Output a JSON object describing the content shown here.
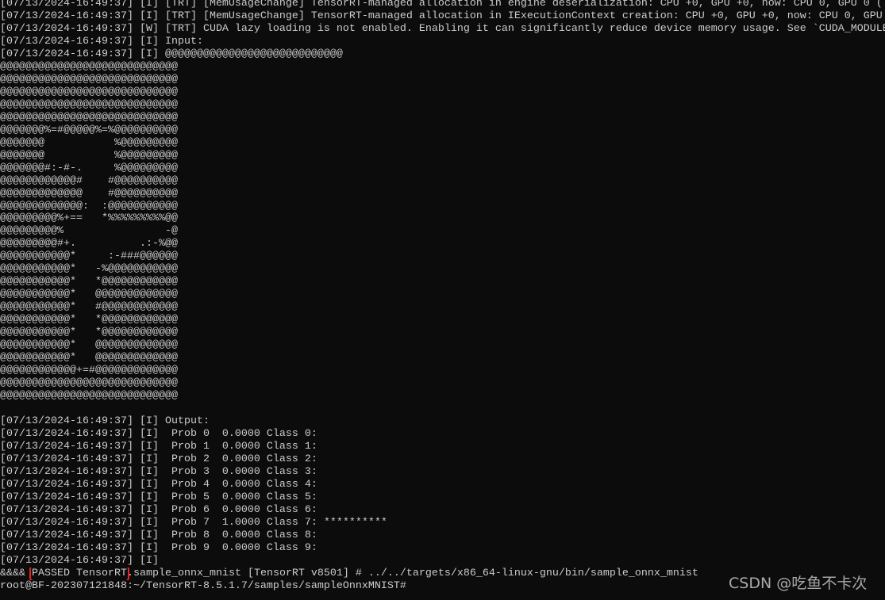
{
  "terminal": {
    "lines": [
      "[07/13/2024-16:49:37] [I] [TRT] [MemUsageChange] TensorRT-managed allocation in engine deserialization: CPU +0, GPU +0, now: CPU 0, GPU 0 (",
      "[07/13/2024-16:49:37] [I] [TRT] [MemUsageChange] TensorRT-managed allocation in IExecutionContext creation: CPU +0, GPU +0, now: CPU 0, GPU",
      "[07/13/2024-16:49:37] [W] [TRT] CUDA lazy loading is not enabled. Enabling it can significantly reduce device memory usage. See `CUDA_MODULE",
      "[07/13/2024-16:49:37] [I] Input:",
      "[07/13/2024-16:49:37] [I] @@@@@@@@@@@@@@@@@@@@@@@@@@@@",
      "@@@@@@@@@@@@@@@@@@@@@@@@@@@@",
      "@@@@@@@@@@@@@@@@@@@@@@@@@@@@",
      "@@@@@@@@@@@@@@@@@@@@@@@@@@@@",
      "@@@@@@@@@@@@@@@@@@@@@@@@@@@@",
      "@@@@@@@@@@@@@@@@@@@@@@@@@@@@",
      "@@@@@@@%=#@@@@@%=%@@@@@@@@@@",
      "@@@@@@@           %@@@@@@@@@",
      "@@@@@@@           %@@@@@@@@@",
      "@@@@@@@#:-#-.     %@@@@@@@@@",
      "@@@@@@@@@@@@#    #@@@@@@@@@@",
      "@@@@@@@@@@@@@    #@@@@@@@@@@",
      "@@@@@@@@@@@@@:  :@@@@@@@@@@@",
      "@@@@@@@@@%+==   *%%%%%%%%%@@",
      "@@@@@@@@@%                -@",
      "@@@@@@@@@#+.          .:-%@@",
      "@@@@@@@@@@@*     :-###@@@@@@",
      "@@@@@@@@@@@*   -%@@@@@@@@@@@",
      "@@@@@@@@@@@*   *@@@@@@@@@@@@",
      "@@@@@@@@@@@*   @@@@@@@@@@@@@",
      "@@@@@@@@@@@*   #@@@@@@@@@@@@",
      "@@@@@@@@@@@*   *@@@@@@@@@@@@",
      "@@@@@@@@@@@*   *@@@@@@@@@@@@",
      "@@@@@@@@@@@*   @@@@@@@@@@@@@",
      "@@@@@@@@@@@*   @@@@@@@@@@@@@",
      "@@@@@@@@@@@@+=#@@@@@@@@@@@@@",
      "@@@@@@@@@@@@@@@@@@@@@@@@@@@@",
      "@@@@@@@@@@@@@@@@@@@@@@@@@@@@",
      "",
      "[07/13/2024-16:49:37] [I] Output:",
      "[07/13/2024-16:49:37] [I]  Prob 0  0.0000 Class 0:",
      "[07/13/2024-16:49:37] [I]  Prob 1  0.0000 Class 1:",
      "[07/13/2024-16:49:37] [I]  Prob 2  0.0000 Class 2:",
      "[07/13/2024-16:49:37] [I]  Prob 3  0.0000 Class 3:",
      "[07/13/2024-16:49:37] [I]  Prob 4  0.0000 Class 4:",
      "[07/13/2024-16:49:37] [I]  Prob 5  0.0000 Class 5:",
      "[07/13/2024-16:49:37] [I]  Prob 6  0.0000 Class 6:",
      "[07/13/2024-16:49:37] [I]  Prob 7  1.0000 Class 7: **********",
      "[07/13/2024-16:49:37] [I]  Prob 8  0.0000 Class 8:",
      "[07/13/2024-16:49:37] [I]  Prob 9  0.0000 Class 9:",
      "[07/13/2024-16:49:37] [I]"
    ],
    "result_line": {
      "prefix": "&&&& ",
      "status": "PASSED TensorRT",
      "rest": ".sample_onnx_mnist [TensorRT v8501] # ../../targets/x86_64-linux-gnu/bin/sample_onnx_mnist"
    },
    "prompt": "root@BF-202307121848:~/TensorRT-8.5.1.7/samples/sampleOnnxMNIST#"
  },
  "watermark": "CSDN @吃鱼不卡次",
  "colors": {
    "background": "#0c0c0c",
    "text": "#cccccc",
    "highlight_box": "#e8231f"
  }
}
